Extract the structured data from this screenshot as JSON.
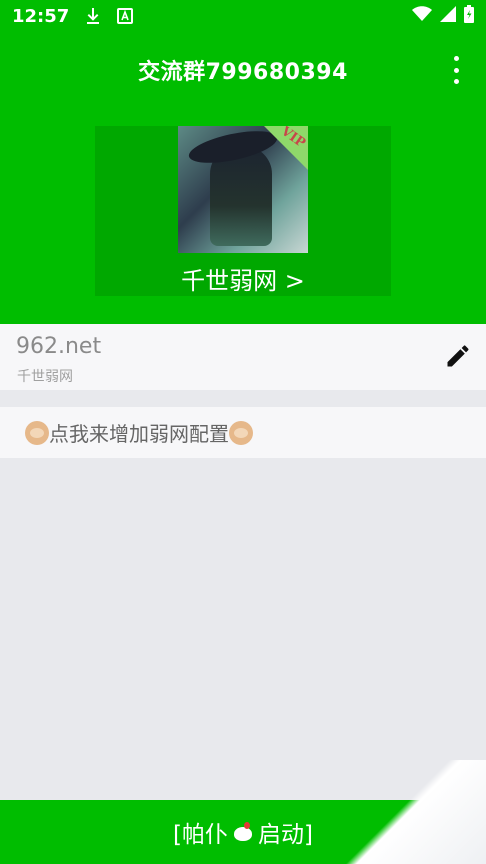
{
  "status_bar": {
    "time": "12:57",
    "icons": [
      "download-icon",
      "a-icon",
      "wifi-icon",
      "signal-icon",
      "battery-icon"
    ]
  },
  "app_bar": {
    "title": "交流群799680394",
    "menu_icon": "more-vert-icon"
  },
  "profile": {
    "badge": "VIP",
    "link_label": "千世弱网 >"
  },
  "config": {
    "host": "962.net",
    "name": "千世弱网",
    "edit_icon": "pencil-icon"
  },
  "add_config": {
    "label": "点我来增加弱网配置"
  },
  "start_button": {
    "label_left": "[帕仆",
    "label_right": "启动]"
  },
  "colors": {
    "brand_green": "#00bd00",
    "card_green": "#00a800",
    "background": "#e8e9ed"
  }
}
